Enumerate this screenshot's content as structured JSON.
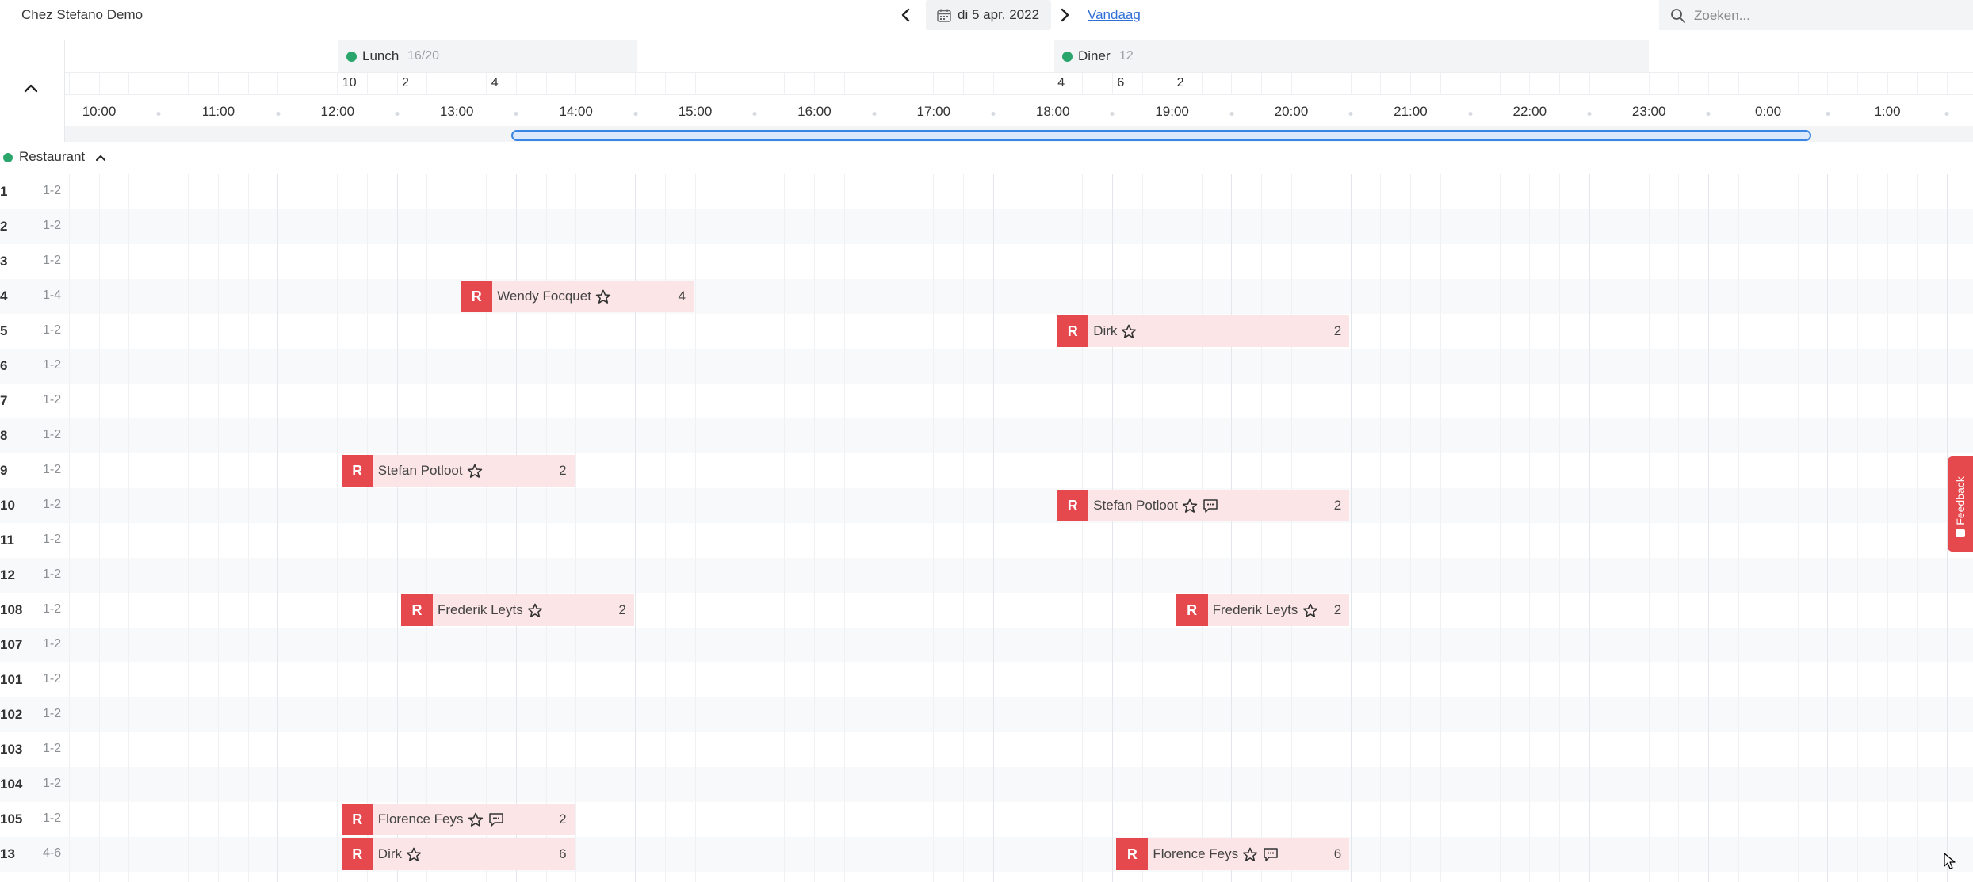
{
  "app": {
    "title": "Chez Stefano Demo"
  },
  "date_nav": {
    "date": "di 5 apr. 2022",
    "today": "Vandaag"
  },
  "search": {
    "placeholder": "Zoeken..."
  },
  "shifts": [
    {
      "name": "Lunch",
      "count": "16/20",
      "status_color": "#2aa56b"
    },
    {
      "name": "Diner",
      "count": "12",
      "status_color": "#2aa56b"
    }
  ],
  "covers": [
    {
      "time": "12:00",
      "value": "10"
    },
    {
      "time": "12:30",
      "value": "2"
    },
    {
      "time": "13:15",
      "value": "4"
    },
    {
      "time": "18:00",
      "value": "4"
    },
    {
      "time": "18:30",
      "value": "6"
    },
    {
      "time": "19:00",
      "value": "2"
    }
  ],
  "timeline": {
    "hours": [
      "10:00",
      "11:00",
      "12:00",
      "13:00",
      "14:00",
      "15:00",
      "16:00",
      "17:00",
      "18:00",
      "19:00",
      "20:00",
      "21:00",
      "22:00",
      "23:00",
      "0:00",
      "1:00"
    ]
  },
  "section": {
    "name": "Restaurant",
    "status_color": "#2aa56b"
  },
  "tables": [
    {
      "name": "1",
      "capacity": "1-2"
    },
    {
      "name": "2",
      "capacity": "1-2"
    },
    {
      "name": "3",
      "capacity": "1-2"
    },
    {
      "name": "4",
      "capacity": "1-4"
    },
    {
      "name": "5",
      "capacity": "1-2"
    },
    {
      "name": "6",
      "capacity": "1-2"
    },
    {
      "name": "7",
      "capacity": "1-2"
    },
    {
      "name": "8",
      "capacity": "1-2"
    },
    {
      "name": "9",
      "capacity": "1-2"
    },
    {
      "name": "10",
      "capacity": "1-2"
    },
    {
      "name": "11",
      "capacity": "1-2"
    },
    {
      "name": "12",
      "capacity": "1-2"
    },
    {
      "name": "108",
      "capacity": "1-2"
    },
    {
      "name": "107",
      "capacity": "1-2"
    },
    {
      "name": "101",
      "capacity": "1-2"
    },
    {
      "name": "102",
      "capacity": "1-2"
    },
    {
      "name": "103",
      "capacity": "1-2"
    },
    {
      "name": "104",
      "capacity": "1-2"
    },
    {
      "name": "105",
      "capacity": "1-2"
    },
    {
      "name": "13",
      "capacity": "4-6"
    }
  ],
  "reservations": [
    {
      "table": "4",
      "start": "13:00",
      "end": "15:00",
      "badge": "R",
      "guest": "Wendy Focquet",
      "icons": [
        "star-icon"
      ],
      "size": "4"
    },
    {
      "table": "5",
      "start": "18:00",
      "end": "20:30",
      "badge": "R",
      "guest": "Dirk",
      "icons": [
        "star-icon"
      ],
      "size": "2"
    },
    {
      "table": "9",
      "start": "12:00",
      "end": "14:00",
      "badge": "R",
      "guest": "Stefan Potloot",
      "icons": [
        "star-icon"
      ],
      "size": "2"
    },
    {
      "table": "10",
      "start": "18:00",
      "end": "20:30",
      "badge": "R",
      "guest": "Stefan Potloot",
      "icons": [
        "star-icon",
        "comment-icon"
      ],
      "size": "2"
    },
    {
      "table": "108",
      "start": "12:30",
      "end": "14:30",
      "badge": "R",
      "guest": "Frederik Leyts",
      "icons": [
        "star-icon"
      ],
      "size": "2"
    },
    {
      "table": "108",
      "start": "19:00",
      "end": "20:30",
      "badge": "R",
      "guest": "Frederik Leyts",
      "icons": [
        "star-icon"
      ],
      "size": "2"
    },
    {
      "table": "105",
      "start": "12:00",
      "end": "14:00",
      "badge": "R",
      "guest": "Florence Feys",
      "icons": [
        "star-icon",
        "comment-icon"
      ],
      "size": "2"
    },
    {
      "table": "13",
      "start": "12:00",
      "end": "14:00",
      "badge": "R",
      "guest": "Dirk",
      "icons": [
        "star-icon"
      ],
      "size": "6"
    },
    {
      "table": "13",
      "start": "18:30",
      "end": "20:30",
      "badge": "R",
      "guest": "Florence Feys",
      "icons": [
        "star-icon",
        "comment-icon"
      ],
      "size": "6"
    }
  ],
  "feedback": {
    "label": "Feedback"
  },
  "colors": {
    "accent": "#e5484d",
    "reservation_bg": "#fbe5e6",
    "link": "#2f6fd6",
    "status_green": "#2aa56b"
  }
}
